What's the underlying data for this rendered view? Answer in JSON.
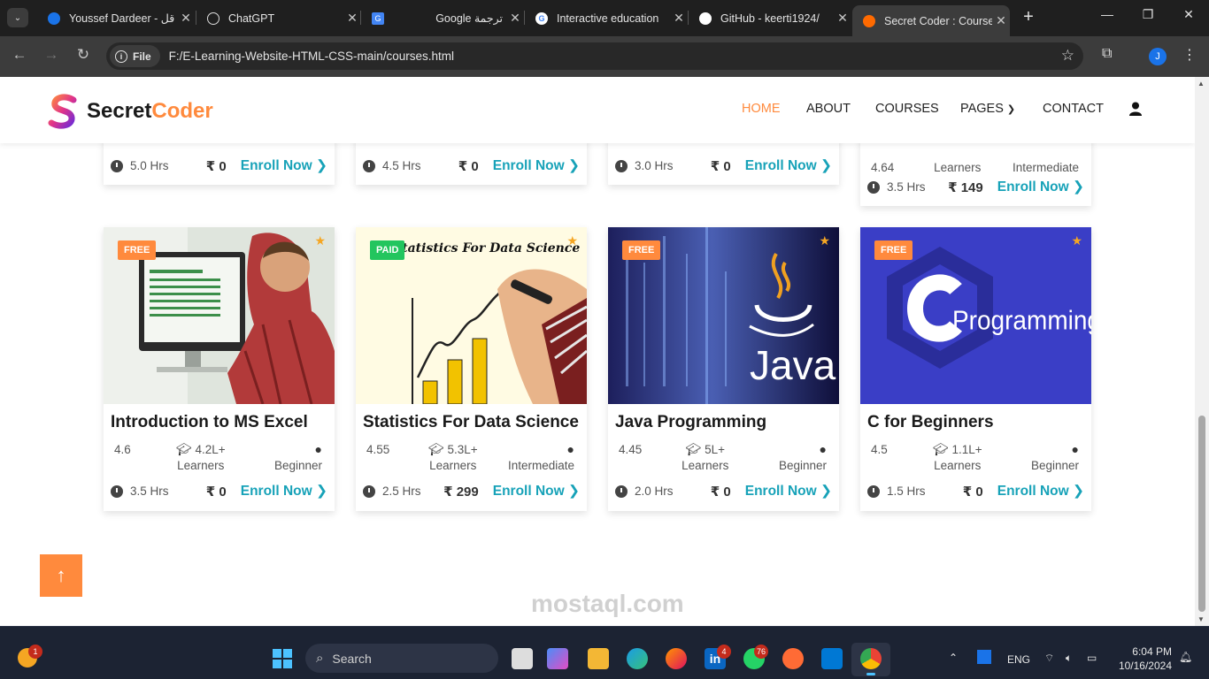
{
  "browser": {
    "tabs": [
      {
        "title": "Youssef Dardeer - قل",
        "favicon_color": "#1a73e8"
      },
      {
        "title": "ChatGPT",
        "favicon_color": "#111111"
      },
      {
        "title": "Google ترجمة",
        "favicon_color": "#4285f4"
      },
      {
        "title": "Interactive education",
        "favicon_color": "#ffffff"
      },
      {
        "title": "GitHub - keerti1924/",
        "favicon_color": "#ffffff"
      },
      {
        "title": "Secret Coder : Course",
        "favicon_color": "#ff6a00",
        "active": true
      }
    ],
    "file_chip": "File",
    "url": "F:/E-Learning-Website-HTML-CSS-main/courses.html",
    "profile_initial": "J"
  },
  "site": {
    "logo_text_main": "Secret",
    "logo_text_accent": "Coder",
    "nav": [
      "HOME",
      "ABOUT",
      "COURSES",
      "PAGES",
      "CONTACT"
    ],
    "nav_active": "HOME"
  },
  "top_row": [
    {
      "hours": "5.0 Hrs",
      "price": "₹ 0",
      "enroll": "Enroll Now"
    },
    {
      "hours": "4.5 Hrs",
      "price": "₹ 0",
      "enroll": "Enroll Now"
    },
    {
      "hours": "3.0 Hrs",
      "price": "₹ 0",
      "enroll": "Enroll Now"
    },
    {
      "rating": "4.64",
      "learners_label": "Learners",
      "level": "Intermediate",
      "hours": "3.5 Hrs",
      "price": "₹ 149",
      "enroll": "Enroll Now"
    }
  ],
  "courses": [
    {
      "badge": "FREE",
      "title": "Introduction to MS Excel",
      "rating": "4.6",
      "learners": "4.2L+",
      "learners_label": "Learners",
      "level": "Beginner",
      "hours": "3.5 Hrs",
      "price": "₹ 0",
      "enroll": "Enroll Now"
    },
    {
      "badge": "PAID",
      "title": "Statistics For Data Science",
      "image_text": "Statistics For Data Science",
      "rating": "4.55",
      "learners": "5.3L+",
      "learners_label": "Learners",
      "level": "Intermediate",
      "hours": "2.5 Hrs",
      "price": "₹ 299",
      "enroll": "Enroll Now"
    },
    {
      "badge": "FREE",
      "title": "Java Programming",
      "image_text": "Java",
      "rating": "4.45",
      "learners": "5L+",
      "learners_label": "Learners",
      "level": "Beginner",
      "hours": "2.0 Hrs",
      "price": "₹ 0",
      "enroll": "Enroll Now"
    },
    {
      "badge": "FREE",
      "title": "C for Beginners",
      "image_text": "Programming",
      "rating": "4.5",
      "learners": "1.1L+",
      "learners_label": "Learners",
      "level": "Beginner",
      "hours": "1.5 Hrs",
      "price": "₹ 0",
      "enroll": "Enroll Now"
    }
  ],
  "taskbar": {
    "search_placeholder": "Search",
    "tray_lang": "ENG",
    "time": "6:04 PM",
    "date": "10/16/2024",
    "weather_badge": "1",
    "linkedin_badge": "4",
    "whatsapp_badge": "76"
  },
  "watermark": "mostaql.com",
  "colors": {
    "accent": "#ff8a3d",
    "enroll": "#17a2b8",
    "paid": "#22c55e"
  }
}
